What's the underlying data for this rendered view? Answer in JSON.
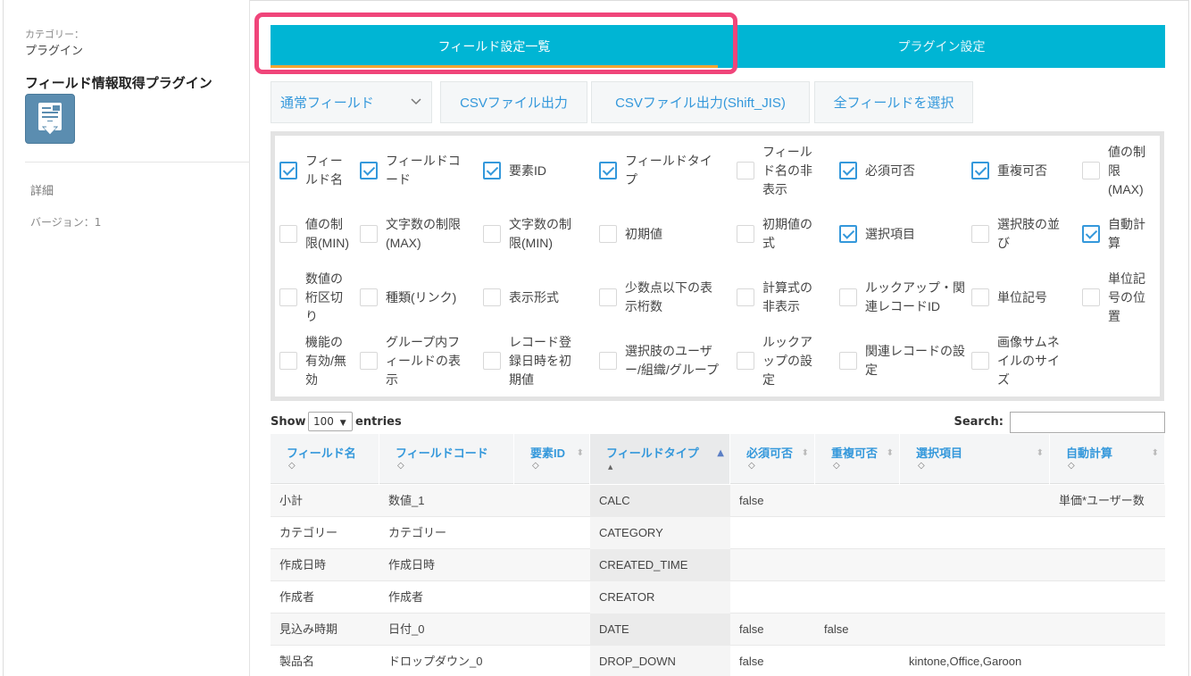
{
  "sidebar": {
    "category_label": "カテゴリー：",
    "category_value": "プラグイン",
    "plugin_title": "フィールド情報取得プラグイン",
    "detail_link": "詳細",
    "version": "バージョン：1"
  },
  "tabs": [
    {
      "label": "フィールド設定一覧",
      "active": true
    },
    {
      "label": "プラグイン設定",
      "active": false
    }
  ],
  "toolbar": {
    "field_select": "通常フィールド",
    "csv_button": "CSVファイル出力",
    "csv_sjis_button": "CSVファイル出力(Shift_JIS)",
    "all_fields_button": "全フィールドを選択"
  },
  "checkboxes": [
    {
      "label": "フィールド名",
      "checked": true
    },
    {
      "label": "フィールドコード",
      "checked": true
    },
    {
      "label": "要素ID",
      "checked": true
    },
    {
      "label": "フィールドタイプ",
      "checked": true
    },
    {
      "label": "フィールド名の非表示",
      "checked": false
    },
    {
      "label": "必須可否",
      "checked": true
    },
    {
      "label": "重複可否",
      "checked": true
    },
    {
      "label": "値の制限(MAX)",
      "checked": false
    },
    {
      "label": "値の制限(MIN)",
      "checked": false
    },
    {
      "label": "文字数の制限(MAX)",
      "checked": false
    },
    {
      "label": "文字数の制限(MIN)",
      "checked": false
    },
    {
      "label": "初期値",
      "checked": false
    },
    {
      "label": "初期値の式",
      "checked": false
    },
    {
      "label": "選択項目",
      "checked": true
    },
    {
      "label": "選択肢の並び",
      "checked": false
    },
    {
      "label": "自動計算",
      "checked": true
    },
    {
      "label": "数値の桁区切り",
      "checked": false
    },
    {
      "label": "種類(リンク)",
      "checked": false
    },
    {
      "label": "表示形式",
      "checked": false
    },
    {
      "label": "少数点以下の表示桁数",
      "checked": false
    },
    {
      "label": "計算式の非表示",
      "checked": false
    },
    {
      "label": "ルックアップ・関連レコードID",
      "checked": false
    },
    {
      "label": "単位記号",
      "checked": false
    },
    {
      "label": "単位記号の位置",
      "checked": false
    },
    {
      "label": "機能の有効/無効",
      "checked": false
    },
    {
      "label": "グループ内フィールドの表示",
      "checked": false
    },
    {
      "label": "レコード登録日時を初期値",
      "checked": false
    },
    {
      "label": "選択肢のユーザー/組織/グループ",
      "checked": false
    },
    {
      "label": "ルックアップの設定",
      "checked": false
    },
    {
      "label": "関連レコードの設定",
      "checked": false
    },
    {
      "label": "画像サムネイルのサイズ",
      "checked": false
    }
  ],
  "datatable": {
    "show_label": "Show",
    "page_length": "100",
    "entries_label": "entries",
    "search_label": "Search:",
    "search_value": "",
    "columns": [
      "フィールド名",
      "フィールドコード",
      "要素ID",
      "フィールドタイプ",
      "必須可否",
      "重複可否",
      "選択項目",
      "自動計算"
    ],
    "sorted_column": "フィールドタイプ",
    "rows": [
      [
        "小計",
        "数値_1",
        "",
        "CALC",
        "false",
        "",
        "",
        "単価*ユーザー数"
      ],
      [
        "カテゴリー",
        "カテゴリー",
        "",
        "CATEGORY",
        "",
        "",
        "",
        ""
      ],
      [
        "作成日時",
        "作成日時",
        "",
        "CREATED_TIME",
        "",
        "",
        "",
        ""
      ],
      [
        "作成者",
        "作成者",
        "",
        "CREATOR",
        "",
        "",
        "",
        ""
      ],
      [
        "見込み時期",
        "日付_0",
        "",
        "DATE",
        "false",
        "false",
        "",
        ""
      ],
      [
        "製品名",
        "ドロップダウン_0",
        "",
        "DROP_DOWN",
        "false",
        "",
        "kintone,Office,Garoon",
        ""
      ]
    ]
  }
}
